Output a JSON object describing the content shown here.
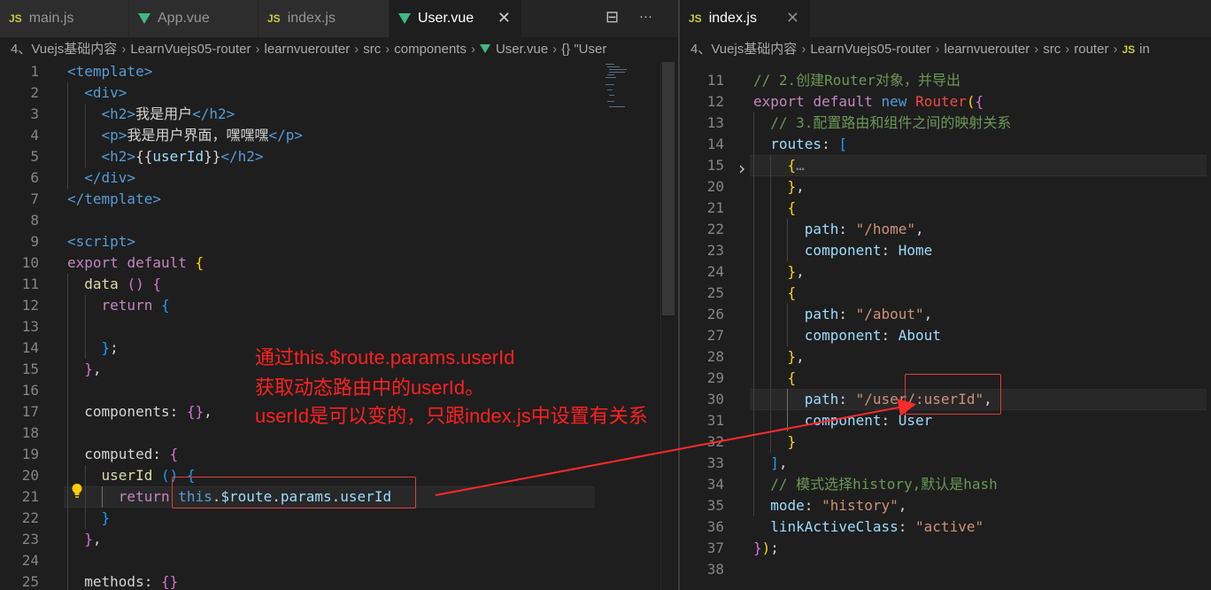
{
  "left_tabs": [
    {
      "icon": "js",
      "label": "main.js"
    },
    {
      "icon": "vue",
      "label": "App.vue"
    },
    {
      "icon": "js",
      "label": "index.js"
    },
    {
      "icon": "vue",
      "label": "User.vue",
      "active": true
    }
  ],
  "left_tab_close": "✕",
  "left_tab_tools": {
    "split": "⊟",
    "more": "···"
  },
  "right_tabs": [
    {
      "icon": "js",
      "label": "index.js",
      "active": true
    }
  ],
  "right_tab_close": "✕",
  "left_breadcrumb": [
    "4、Vuejs基础内容",
    "LearnVuejs05-router",
    "learnvuerouter",
    "src",
    "components",
    "User.vue",
    "{} \"User"
  ],
  "right_breadcrumb": [
    "4、Vuejs基础内容",
    "LearnVuejs05-router",
    "learnvuerouter",
    "src",
    "router",
    "in"
  ],
  "left_code": [
    {
      "n": "1",
      "t": [
        [
          "<template>",
          "t-tag"
        ]
      ]
    },
    {
      "n": "2",
      "t": [
        [
          "  <div>",
          "t-tag"
        ]
      ]
    },
    {
      "n": "3",
      "t": [
        [
          "    <h2>",
          "t-tag"
        ],
        [
          "我是用户",
          "t-txt"
        ],
        [
          "</h2>",
          "t-tag"
        ]
      ]
    },
    {
      "n": "4",
      "t": [
        [
          "    <p>",
          "t-tag"
        ],
        [
          "我是用户界面，嘿嘿嘿",
          "t-txt"
        ],
        [
          "</p>",
          "t-tag"
        ]
      ]
    },
    {
      "n": "5",
      "t": [
        [
          "    <h2>",
          "t-tag"
        ],
        [
          "{{",
          "t-txt"
        ],
        [
          "userId",
          "t-var"
        ],
        [
          "}}",
          "t-txt"
        ],
        [
          "</h2>",
          "t-tag"
        ]
      ]
    },
    {
      "n": "6",
      "t": [
        [
          "  </div>",
          "t-tag"
        ]
      ]
    },
    {
      "n": "7",
      "t": [
        [
          "</template>",
          "t-tag"
        ]
      ]
    },
    {
      "n": "8",
      "t": []
    },
    {
      "n": "9",
      "t": [
        [
          "<script>",
          "t-tag"
        ]
      ]
    },
    {
      "n": "10",
      "t": [
        [
          "export",
          "t-kw"
        ],
        [
          " ",
          "t-txt"
        ],
        [
          "default",
          "t-kw"
        ],
        [
          " ",
          "t-txt"
        ],
        [
          "{",
          "t-b1"
        ]
      ]
    },
    {
      "n": "11",
      "t": [
        [
          "  ",
          "t-txt"
        ],
        [
          "data",
          "t-fn"
        ],
        [
          " ",
          "t-txt"
        ],
        [
          "()",
          "t-b2"
        ],
        [
          " ",
          "t-txt"
        ],
        [
          "{",
          "t-b2"
        ]
      ]
    },
    {
      "n": "12",
      "t": [
        [
          "    ",
          "t-txt"
        ],
        [
          "return",
          "t-kw"
        ],
        [
          " ",
          "t-txt"
        ],
        [
          "{",
          "t-b3"
        ]
      ]
    },
    {
      "n": "13",
      "t": []
    },
    {
      "n": "14",
      "t": [
        [
          "    ",
          "t-txt"
        ],
        [
          "}",
          "t-b3"
        ],
        [
          ";",
          "t-txt"
        ]
      ]
    },
    {
      "n": "15",
      "t": [
        [
          "  ",
          "t-txt"
        ],
        [
          "}",
          "t-b2"
        ],
        [
          ",",
          "t-txt"
        ]
      ]
    },
    {
      "n": "16",
      "t": []
    },
    {
      "n": "17",
      "t": [
        [
          "  components: ",
          "t-txt"
        ],
        [
          "{}",
          "t-b2"
        ],
        [
          ",",
          "t-txt"
        ]
      ]
    },
    {
      "n": "18",
      "t": []
    },
    {
      "n": "19",
      "t": [
        [
          "  computed: ",
          "t-txt"
        ],
        [
          "{",
          "t-b2"
        ]
      ]
    },
    {
      "n": "20",
      "t": [
        [
          "    ",
          "t-txt"
        ],
        [
          "userId",
          "t-fn"
        ],
        [
          " ",
          "t-txt"
        ],
        [
          "()",
          "t-b3"
        ],
        [
          " ",
          "t-txt"
        ],
        [
          "{",
          "t-b3"
        ]
      ]
    },
    {
      "n": "21",
      "t": [
        [
          "      ",
          "t-txt"
        ],
        [
          "return",
          "t-kw"
        ],
        [
          " ",
          "t-txt"
        ],
        [
          "this",
          "t-this"
        ],
        [
          ".",
          "t-txt"
        ],
        [
          "$route",
          "t-var"
        ],
        [
          ".",
          "t-txt"
        ],
        [
          "params",
          "t-var"
        ],
        [
          ".",
          "t-txt"
        ],
        [
          "userId",
          "t-var"
        ]
      ]
    },
    {
      "n": "22",
      "t": [
        [
          "    ",
          "t-txt"
        ],
        [
          "}",
          "t-b3"
        ]
      ]
    },
    {
      "n": "23",
      "t": [
        [
          "  ",
          "t-txt"
        ],
        [
          "}",
          "t-b2"
        ],
        [
          ",",
          "t-txt"
        ]
      ]
    },
    {
      "n": "24",
      "t": []
    },
    {
      "n": "25",
      "t": [
        [
          "  methods: ",
          "t-txt"
        ],
        [
          "{}",
          "t-b2"
        ]
      ]
    }
  ],
  "right_code": [
    {
      "n": "11",
      "t": [
        [
          "// 2.创建Router对象，并导出",
          "t-com"
        ]
      ]
    },
    {
      "n": "12",
      "t": [
        [
          "export",
          "t-kw"
        ],
        [
          " ",
          "t-txt"
        ],
        [
          "default",
          "t-kw"
        ],
        [
          " ",
          "t-txt"
        ],
        [
          "new",
          "t-tag"
        ],
        [
          " ",
          "t-txt"
        ],
        [
          "Router",
          "t-red"
        ],
        [
          "(",
          "t-b1"
        ],
        [
          "{",
          "t-b2"
        ]
      ]
    },
    {
      "n": "13",
      "t": [
        [
          "  ",
          "t-txt"
        ],
        [
          "// 3.配置路由和组件之间的映射关系",
          "t-com"
        ]
      ]
    },
    {
      "n": "14",
      "t": [
        [
          "  ",
          "t-txt"
        ],
        [
          "routes",
          "t-var"
        ],
        [
          ": ",
          "t-txt"
        ],
        [
          "[",
          "t-b3"
        ]
      ]
    },
    {
      "n": "15",
      "t": [
        [
          "    ",
          "t-txt"
        ],
        [
          "{",
          "t-b1"
        ],
        [
          "…",
          "t-dim"
        ]
      ]
    },
    {
      "n": "20",
      "t": [
        [
          "    ",
          "t-txt"
        ],
        [
          "}",
          "t-b1"
        ],
        [
          ",",
          "t-txt"
        ]
      ]
    },
    {
      "n": "21",
      "t": [
        [
          "    ",
          "t-txt"
        ],
        [
          "{",
          "t-b1"
        ]
      ]
    },
    {
      "n": "22",
      "t": [
        [
          "      ",
          "t-txt"
        ],
        [
          "path",
          "t-var"
        ],
        [
          ": ",
          "t-txt"
        ],
        [
          "\"/home\"",
          "t-str"
        ],
        [
          ",",
          "t-txt"
        ]
      ]
    },
    {
      "n": "23",
      "t": [
        [
          "      ",
          "t-txt"
        ],
        [
          "component",
          "t-var"
        ],
        [
          ": ",
          "t-txt"
        ],
        [
          "Home",
          "t-var"
        ]
      ]
    },
    {
      "n": "24",
      "t": [
        [
          "    ",
          "t-txt"
        ],
        [
          "}",
          "t-b1"
        ],
        [
          ",",
          "t-txt"
        ]
      ]
    },
    {
      "n": "25",
      "t": [
        [
          "    ",
          "t-txt"
        ],
        [
          "{",
          "t-b1"
        ]
      ]
    },
    {
      "n": "26",
      "t": [
        [
          "      ",
          "t-txt"
        ],
        [
          "path",
          "t-var"
        ],
        [
          ": ",
          "t-txt"
        ],
        [
          "\"/about\"",
          "t-str"
        ],
        [
          ",",
          "t-txt"
        ]
      ]
    },
    {
      "n": "27",
      "t": [
        [
          "      ",
          "t-txt"
        ],
        [
          "component",
          "t-var"
        ],
        [
          ": ",
          "t-txt"
        ],
        [
          "About",
          "t-var"
        ]
      ]
    },
    {
      "n": "28",
      "t": [
        [
          "    ",
          "t-txt"
        ],
        [
          "}",
          "t-b1"
        ],
        [
          ",",
          "t-txt"
        ]
      ]
    },
    {
      "n": "29",
      "t": [
        [
          "    ",
          "t-txt"
        ],
        [
          "{",
          "t-b1"
        ]
      ]
    },
    {
      "n": "30",
      "t": [
        [
          "      ",
          "t-txt"
        ],
        [
          "path",
          "t-var"
        ],
        [
          ": ",
          "t-txt"
        ],
        [
          "\"/user/:userId\"",
          "t-str"
        ],
        [
          ",",
          "t-txt"
        ]
      ]
    },
    {
      "n": "31",
      "t": [
        [
          "      ",
          "t-txt"
        ],
        [
          "component",
          "t-var"
        ],
        [
          ": ",
          "t-txt"
        ],
        [
          "User",
          "t-var"
        ]
      ]
    },
    {
      "n": "32",
      "t": [
        [
          "    ",
          "t-txt"
        ],
        [
          "}",
          "t-b1"
        ]
      ]
    },
    {
      "n": "33",
      "t": [
        [
          "  ",
          "t-txt"
        ],
        [
          "]",
          "t-b3"
        ],
        [
          ",",
          "t-txt"
        ]
      ]
    },
    {
      "n": "34",
      "t": [
        [
          "  ",
          "t-txt"
        ],
        [
          "// 模式选择history,默认是hash",
          "t-com"
        ]
      ]
    },
    {
      "n": "35",
      "t": [
        [
          "  ",
          "t-txt"
        ],
        [
          "mode",
          "t-var"
        ],
        [
          ": ",
          "t-txt"
        ],
        [
          "\"history\"",
          "t-str"
        ],
        [
          ",",
          "t-txt"
        ]
      ]
    },
    {
      "n": "36",
      "t": [
        [
          "  ",
          "t-txt"
        ],
        [
          "linkActiveClass",
          "t-var"
        ],
        [
          ": ",
          "t-txt"
        ],
        [
          "\"active\"",
          "t-str"
        ]
      ]
    },
    {
      "n": "37",
      "t": [
        [
          "}",
          "t-b2"
        ],
        [
          ")",
          "t-b1"
        ],
        [
          ";",
          "t-txt"
        ]
      ]
    },
    {
      "n": "38",
      "t": []
    }
  ],
  "annotation": {
    "lines": [
      "通过this.$route.params.userId",
      "获取动态路由中的userId。",
      "userId是可以变的，只跟index.js中设置有关系"
    ],
    "color": "#ff2020"
  },
  "colors": {
    "editor_bg": "#1e1e1e",
    "tabbar_bg": "#252526",
    "inactive_tab_bg": "#2d2d2d",
    "js_icon": "#cbcb41",
    "vue_icon": "#41b883",
    "annotation_red": "#e33b3b"
  },
  "icons": {
    "js_file": "js-file-icon",
    "vue_file": "vue-file-icon",
    "close": "close-icon",
    "split_editor": "split-editor-icon",
    "more_actions": "more-actions-icon",
    "fold": "chevron-right-icon",
    "lightbulb": "lightbulb-icon"
  }
}
